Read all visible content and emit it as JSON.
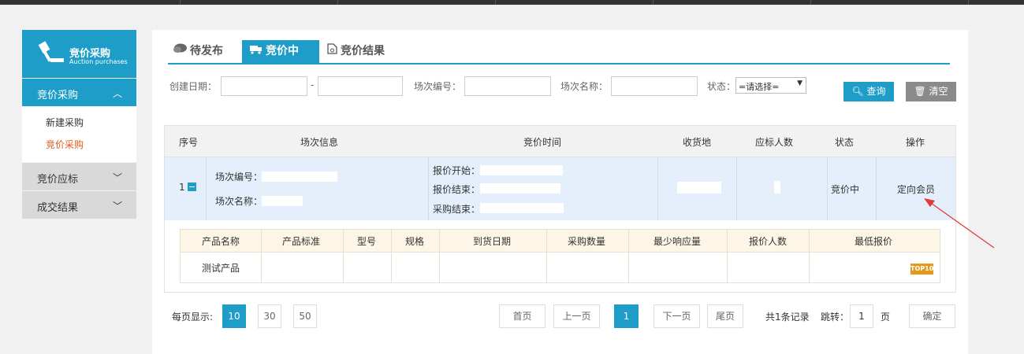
{
  "sidebar": {
    "title": "竞价采购",
    "subtitle": "Auction purchases",
    "sections": [
      {
        "label": "竞价采购",
        "chevron": "︿"
      },
      {
        "label": "竞价应标",
        "chevron": "﹀"
      },
      {
        "label": "成交结果",
        "chevron": "﹀"
      }
    ],
    "sub_items": [
      {
        "label": "新建采购"
      },
      {
        "label": "竞价采购"
      }
    ]
  },
  "tabs": [
    {
      "label": "待发布",
      "icon": "chat-bubble-icon"
    },
    {
      "label": "竞价中",
      "icon": "truck-icon"
    },
    {
      "label": "竞价结果",
      "icon": "document-icon"
    }
  ],
  "filter": {
    "created_date_label": "创建日期：",
    "dash": "-",
    "session_no_label": "场次编号：",
    "session_name_label": "场次名称：",
    "status_label": "状态：",
    "status_value": "=请选择=",
    "search_label": "查询",
    "clear_label": "清空"
  },
  "table": {
    "headers": [
      "序号",
      "场次信息",
      "竞价时间",
      "收货地",
      "应标人数",
      "状态",
      "操作"
    ],
    "row": {
      "index": "1",
      "session_no_label": "场次编号：",
      "session_name_label": "场次名称：",
      "quote_start_label": "报价开始：",
      "quote_end_label": "报价结束：",
      "purchase_end_label": "采购结束：",
      "status": "竞价中",
      "action": "定向会员"
    },
    "sub_headers": [
      "产品名称",
      "产品标准",
      "型号",
      "规格",
      "到货日期",
      "采购数量",
      "最少响应量",
      "报价人数",
      "最低报价"
    ],
    "sub_row": {
      "product_name": "测试产品",
      "badge": "TOP10"
    }
  },
  "pager": {
    "per_page_label": "每页显示:",
    "sizes": [
      "10",
      "30",
      "50"
    ],
    "first": "首页",
    "prev": "上一页",
    "current": "1",
    "next": "下一页",
    "last": "尾页",
    "total": "共1条记录",
    "jump_label": "跳转：",
    "jump_value": "1",
    "page_unit": "页",
    "confirm": "确定"
  },
  "colors": {
    "accent": "#1e9dc8",
    "active_link": "#e05a1e",
    "row_highlight": "#e4effb",
    "sub_header": "#fdf6e6",
    "annotation_arrow": "#e03a3a"
  }
}
